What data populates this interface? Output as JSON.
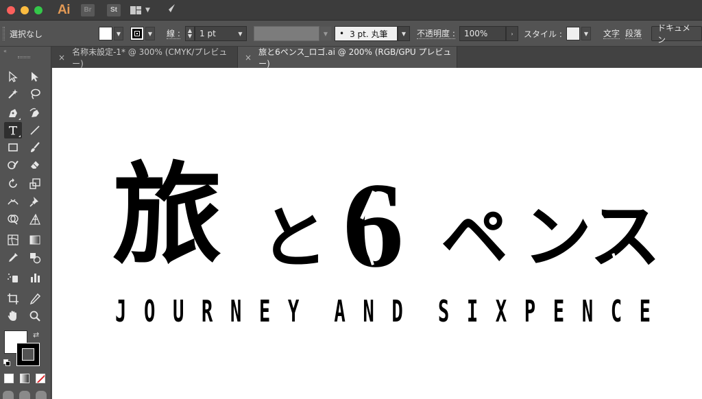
{
  "titlebar": {
    "app_logo": "Ai",
    "bridge_chip": "Br",
    "stock_chip": "St"
  },
  "control_bar": {
    "selection_label": "選択なし",
    "stroke_label": "線 :",
    "stroke_weight": "1 pt",
    "brush_dot": "•",
    "brush_value": "3 pt. 丸筆",
    "opacity_label": "不透明度 :",
    "opacity_value": "100%",
    "style_label": "スタイル :",
    "character_link": "文字",
    "paragraph_link": "段落",
    "document_button": "ドキュメン"
  },
  "tabs": [
    {
      "close": "×",
      "label": "名称未設定-1* @ 300% (CMYK/プレビュー)",
      "active": false
    },
    {
      "close": "×",
      "label": "旅と6ペンス_ロゴ.ai @ 200% (RGB/GPU プレビュー)",
      "active": true
    }
  ],
  "artwork": {
    "jp_chars": [
      "旅",
      "と",
      "6",
      "ペ",
      "ン",
      "ス"
    ],
    "en_letters": [
      "J",
      "O",
      "U",
      "R",
      "N",
      "E",
      "Y",
      " ",
      "A",
      "N",
      "D",
      " ",
      "S",
      "I",
      "X",
      "P",
      "E",
      "N",
      "C",
      "E"
    ]
  },
  "toolbar": {
    "collapse": "«",
    "swap": "⇄"
  },
  "colors": {
    "app_logo": "#e49a55",
    "panel_bg": "#535353",
    "titlebar_bg": "#3c3c3c",
    "canvas_bg": "#ffffff",
    "artwork": "#000000"
  }
}
